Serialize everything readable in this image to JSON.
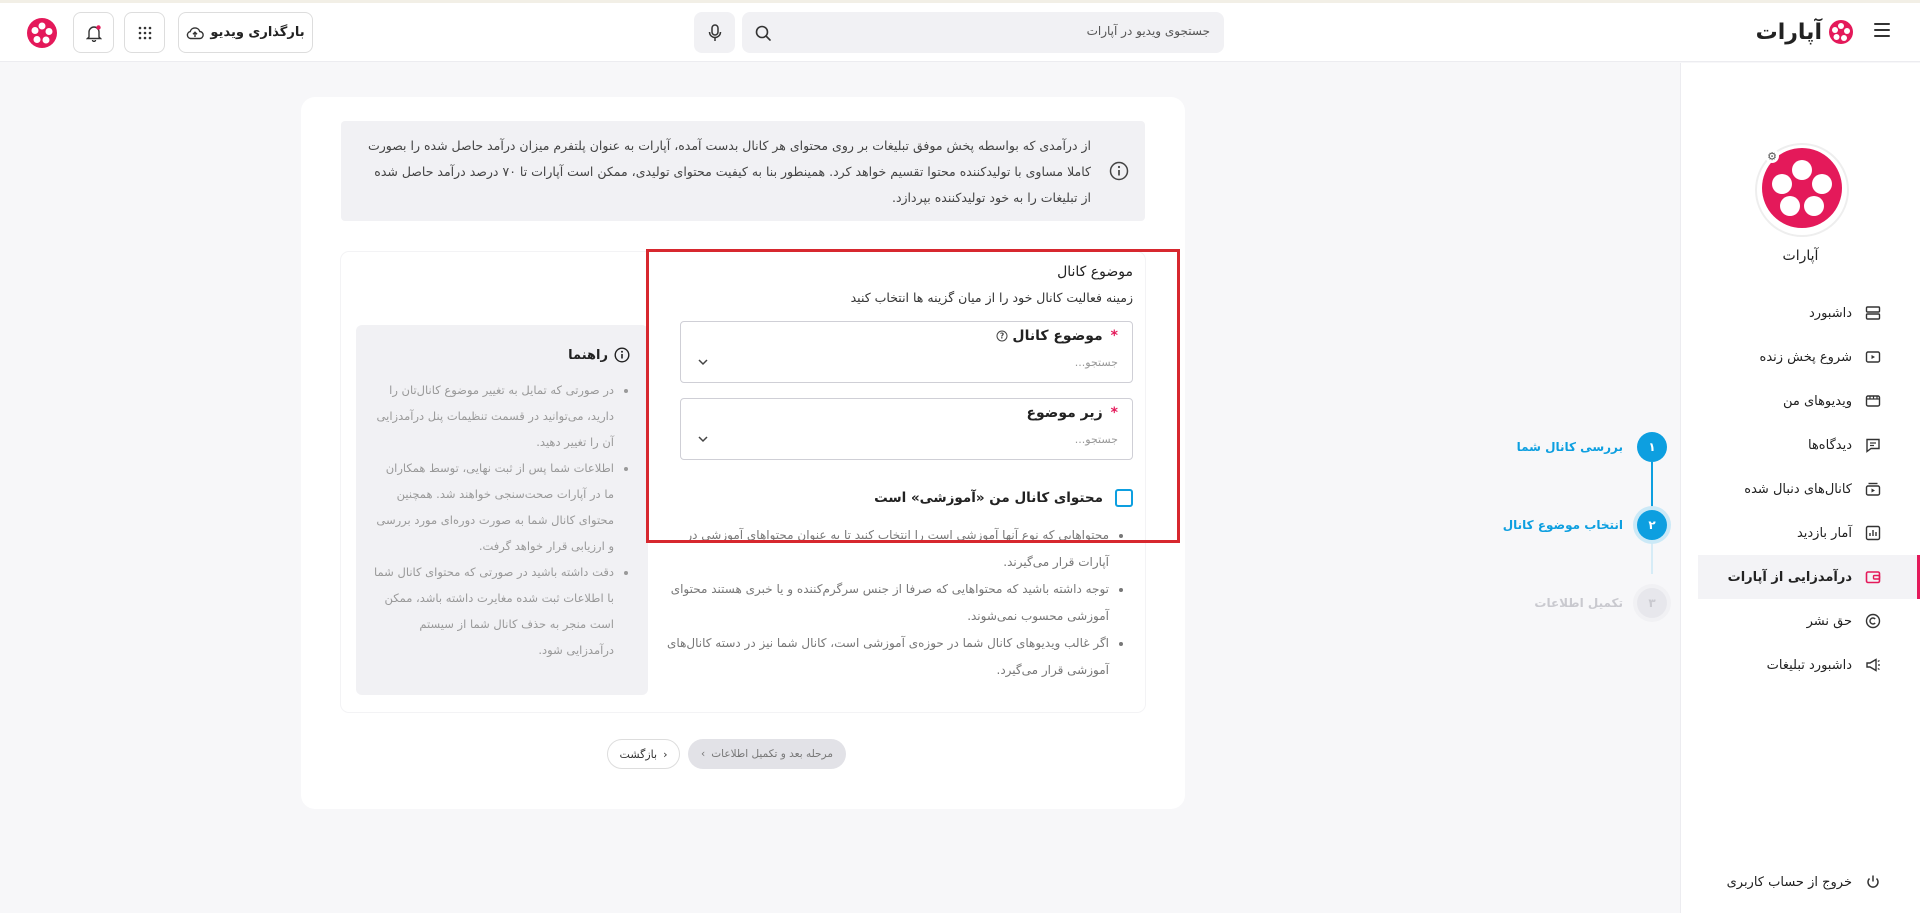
{
  "header": {
    "logo_text": "آپارات",
    "search_placeholder": "جستجوی ویدیو در آپارات",
    "upload_label": "بارگذاری ویدیو"
  },
  "sidebar": {
    "channel_name": "آپارات",
    "items": [
      {
        "label": "داشبورد",
        "icon": "dashboard-icon"
      },
      {
        "label": "شروع پخش زنده",
        "icon": "live-icon"
      },
      {
        "label": "ویدیوهای من",
        "icon": "videos-icon"
      },
      {
        "label": "دیدگاه‌ها",
        "icon": "comments-icon"
      },
      {
        "label": "کانال‌های دنبال شده",
        "icon": "subscriptions-icon"
      },
      {
        "label": "آمار بازدید",
        "icon": "stats-icon"
      },
      {
        "label": "درآمدزایی از آپارات",
        "icon": "wallet-icon",
        "active": true
      },
      {
        "label": "حق نشر",
        "icon": "copyright-icon"
      },
      {
        "label": "داشبورد تبلیغات",
        "icon": "megaphone-icon"
      }
    ],
    "logout_label": "خروج از حساب کاربری"
  },
  "steps": [
    {
      "number": "۱",
      "label": "بررسی کانال شما",
      "state": "done"
    },
    {
      "number": "۲",
      "label": "انتخاب موضوع کانال",
      "state": "current"
    },
    {
      "number": "۳",
      "label": "تکمیل اطلاعات",
      "state": "pending"
    }
  ],
  "info_banner": {
    "text": "از درآمدی که بواسطه پخش موفق تبلیغات بر روی محتوای هر کانال بدست آمده، آپارات به عنوان پلتفرم میزان درآمد حاصل شده را بصورت کاملا مساوی با تولیدکننده محتوا تقسیم خواهد کرد. همینطور بنا به کیفیت محتوای تولیدی، ممکن است آپارات تا ۷۰ درصد درآمد حاصل شده از تبلیغات را به خود تولیدکننده بپردازد."
  },
  "form": {
    "section_title": "موضوع کانال",
    "section_subtitle": "زمینه فعالیت کانال خود را از میان گزینه ها انتخاب کنید",
    "topic_label": "موضوع کانال",
    "topic_placeholder": "جستجو...",
    "subtopic_label": "زیر موضوع",
    "subtopic_placeholder": "جستجو...",
    "required_mark": "*",
    "educational_checkbox_label": "محتوای کانال من «آموزشی» است",
    "educational_checked": false,
    "educational_notes": [
      "محتواهایی که نوع آنها آموزشی است را انتخاب کنید تا به عنوان محتواهای آموزشی در آپارات قرار می‌گیرند.",
      "توجه داشته باشید که محتواهایی که صرفا از جنس سرگرم‌کننده و یا خبری هستند محتوای آموزشی محسوب نمی‌شوند.",
      "اگر غالب ویدیوهای کانال شما در حوزه‌ی آموزشی است، کانال شما نیز در دسته کانال‌های آموزشی قرار می‌گیرد."
    ]
  },
  "guide": {
    "title": "راهنما",
    "items": [
      "در صورتی که تمایل به تغییر موضوع کانال‌تان را دارید، می‌توانید در قسمت تنظیمات پنل درآمدزایی آن را تغییر دهید.",
      "اطلاعات شما پس از ثبت نهایی، توسط همکاران ما در آپارات صحت‌سنجی خواهند شد. همچنین محتوای کانال شما به صورت دوره‌ای مورد بررسی و ارزیابی قرار خواهد گرفت.",
      "دقت داشته باشید در صورتی که محتوای کانال شما با اطلاعات ثبت شده مغایرت داشته باشد، ممکن است منجر به حذف کانال شما از سیستم درآمدزایی شود."
    ]
  },
  "nav": {
    "back_label": "بازگشت",
    "next_label": "مرحله بعد و تکمیل اطلاعات"
  },
  "colors": {
    "brand": "#e4195a",
    "accent": "#0d9fe0",
    "highlight": "#d7282f"
  }
}
